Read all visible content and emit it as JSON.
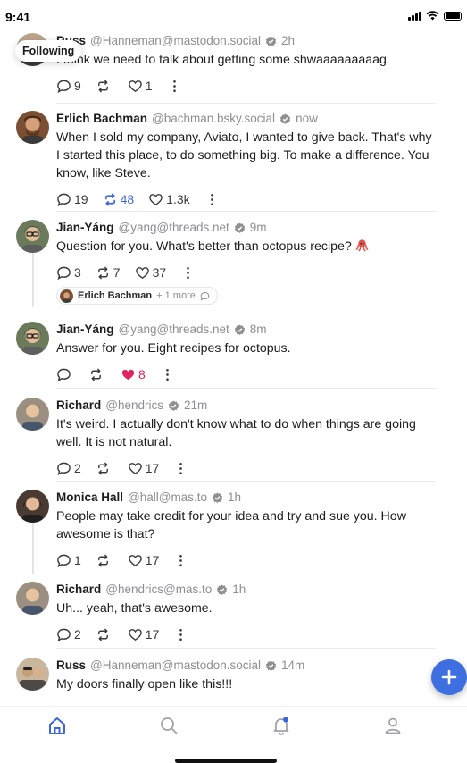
{
  "status_bar": {
    "time": "9:41"
  },
  "header": {
    "filter_label": "Following"
  },
  "colors": {
    "accent": "#3f66d8",
    "like": "#e0245e",
    "fab": "#3d6fe0",
    "muted": "#8e8e93"
  },
  "posts": [
    {
      "author": "Russ",
      "handle": "@Hanneman@mastodon.social",
      "verified": true,
      "time": "2h",
      "text": "I think we need to talk about getting some shwaaaaaaaaag.",
      "replies": "9",
      "boosts": "",
      "likes": "1"
    },
    {
      "author": "Erlich Bachman",
      "handle": "@bachman.bsky.social",
      "verified": false,
      "time": "now",
      "text": "When I sold my company, Aviato, I wanted to give back. That's why I started this place, to do something big. To make a difference. You know, like Steve.",
      "replies": "19",
      "boosts": "48",
      "likes": "1.3k",
      "boosted": true
    },
    {
      "author": "Jian-Yáng",
      "handle": "@yang@threads.net",
      "verified": true,
      "time": "9m",
      "text": "Question for you. What's better than octopus recipe?",
      "replies": "3",
      "boosts": "7",
      "likes": "37"
    },
    {
      "author": "Jian-Yáng",
      "handle": "@yang@threads.net",
      "verified": true,
      "time": "8m",
      "text": "Answer for you. Eight recipes for octopus.",
      "replies": "",
      "boosts": "",
      "likes": "8",
      "liked": true
    },
    {
      "author": "Richard",
      "handle": "@hendrics",
      "verified": true,
      "time": "21m",
      "text": "It's weird. I actually don't know what to do when things are going well. It is not natural.",
      "replies": "2",
      "boosts": "",
      "likes": "17"
    },
    {
      "author": "Monica Hall",
      "handle": "@hall@mas.to",
      "verified": true,
      "time": "1h",
      "text": "People may take credit for your idea and try and sue you. How awesome is that?",
      "replies": "1",
      "boosts": "",
      "likes": "17"
    },
    {
      "author": "Richard",
      "handle": "@hendrics@mas.to",
      "verified": true,
      "time": "1h",
      "text": "Uh... yeah, that's awesome.",
      "replies": "2",
      "boosts": "",
      "likes": "17"
    },
    {
      "author": "Russ",
      "handle": "@Hanneman@mastodon.social",
      "verified": true,
      "time": "14m",
      "text": "My doors finally open like this!!!",
      "replies": "",
      "boosts": "",
      "likes": ""
    }
  ],
  "context_chip": {
    "name": "Erlich Bachman",
    "more": "+ 1 more"
  },
  "tabs": [
    {
      "name": "home",
      "icon": "home-icon",
      "active": true
    },
    {
      "name": "search",
      "icon": "search-icon"
    },
    {
      "name": "notifications",
      "icon": "bell-icon",
      "badge": true
    },
    {
      "name": "profile",
      "icon": "profile-icon"
    }
  ],
  "fab": {
    "icon": "plus-icon"
  }
}
